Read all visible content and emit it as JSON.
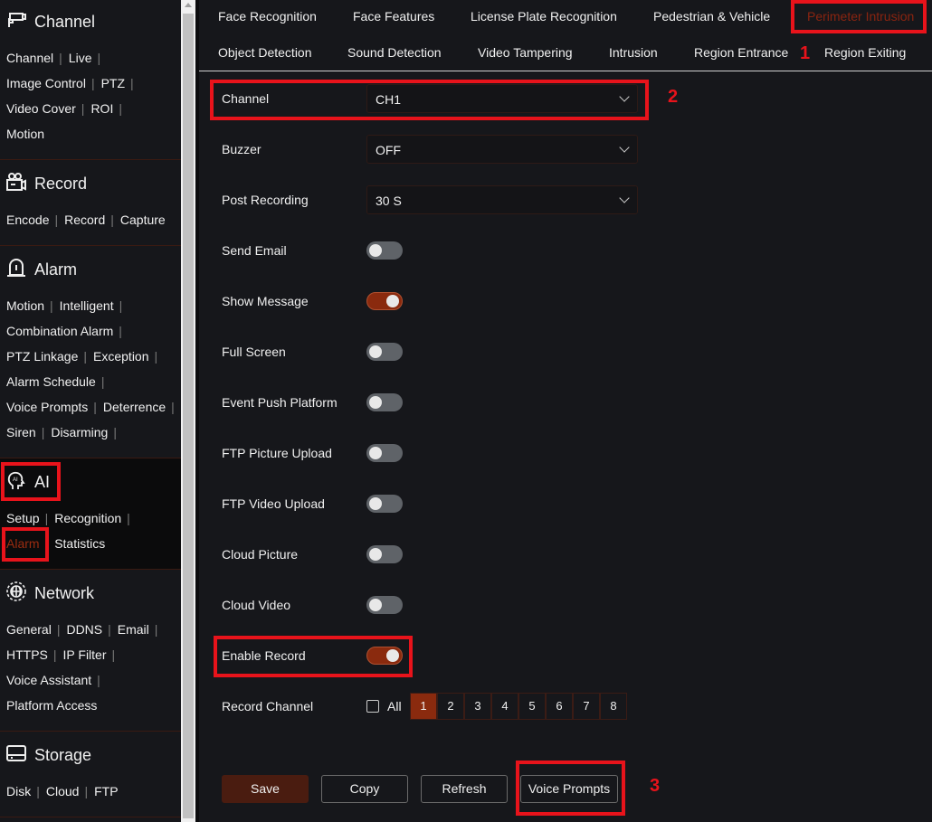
{
  "sidebar": {
    "sections": [
      {
        "title": "Channel",
        "icon": "camera-icon",
        "rows": [
          [
            "Channel",
            "Live"
          ],
          [
            "Image Control",
            "PTZ"
          ],
          [
            "Video Cover",
            "ROI"
          ],
          [
            "Motion"
          ]
        ]
      },
      {
        "title": "Record",
        "icon": "video-recorder-icon",
        "rows": [
          [
            "Encode",
            "Record",
            "Capture"
          ]
        ]
      },
      {
        "title": "Alarm",
        "icon": "alarm-icon",
        "rows": [
          [
            "Motion",
            "Intelligent"
          ],
          [
            "Combination Alarm"
          ],
          [
            "PTZ Linkage",
            "Exception"
          ],
          [
            "Alarm Schedule"
          ],
          [
            "Voice Prompts",
            "Deterrence"
          ],
          [
            "Siren",
            "Disarming"
          ]
        ]
      },
      {
        "title": "AI",
        "icon": "ai-head-icon",
        "rows": [
          [
            "Setup",
            "Recognition"
          ],
          [
            "Alarm",
            "Statistics"
          ]
        ],
        "selected_item": "Alarm"
      },
      {
        "title": "Network",
        "icon": "globe-icon",
        "rows": [
          [
            "General",
            "DDNS",
            "Email"
          ],
          [
            "HTTPS",
            "IP Filter"
          ],
          [
            "Voice Assistant"
          ],
          [
            "Platform Access"
          ]
        ]
      },
      {
        "title": "Storage",
        "icon": "storage-icon",
        "rows": [
          [
            "Disk",
            "Cloud",
            "FTP"
          ]
        ]
      }
    ]
  },
  "tabs": {
    "row1": [
      "Face Recognition",
      "Face Features",
      "License Plate Recognition",
      "Pedestrian & Vehicle",
      "Perimeter Intrusion"
    ],
    "row2": [
      "Object Detection",
      "Sound Detection",
      "Video Tampering",
      "Intrusion",
      "Region Entrance",
      "Region Exiting"
    ],
    "selected": "Perimeter Intrusion"
  },
  "form": {
    "channel": {
      "label": "Channel",
      "value": "CH1"
    },
    "buzzer": {
      "label": "Buzzer",
      "value": "OFF"
    },
    "post_recording": {
      "label": "Post Recording",
      "value": "30 S"
    },
    "toggles": [
      {
        "label": "Send Email",
        "on": false
      },
      {
        "label": "Show Message",
        "on": true
      },
      {
        "label": "Full Screen",
        "on": false
      },
      {
        "label": "Event Push Platform",
        "on": false
      },
      {
        "label": "FTP Picture Upload",
        "on": false
      },
      {
        "label": "FTP Video Upload",
        "on": false
      },
      {
        "label": "Cloud Picture",
        "on": false
      },
      {
        "label": "Cloud Video",
        "on": false
      },
      {
        "label": "Enable Record",
        "on": true
      }
    ],
    "record_channel": {
      "label": "Record Channel",
      "all_label": "All",
      "all_checked": false,
      "channels": [
        "1",
        "2",
        "3",
        "4",
        "5",
        "6",
        "7",
        "8"
      ],
      "selected": "1"
    }
  },
  "buttons": {
    "save": "Save",
    "copy": "Copy",
    "refresh": "Refresh",
    "voice_prompts": "Voice Prompts"
  },
  "annotations": [
    "1",
    "2",
    "3"
  ],
  "colors": {
    "accent": "#8a2a0e",
    "annotation": "#e8131b"
  }
}
